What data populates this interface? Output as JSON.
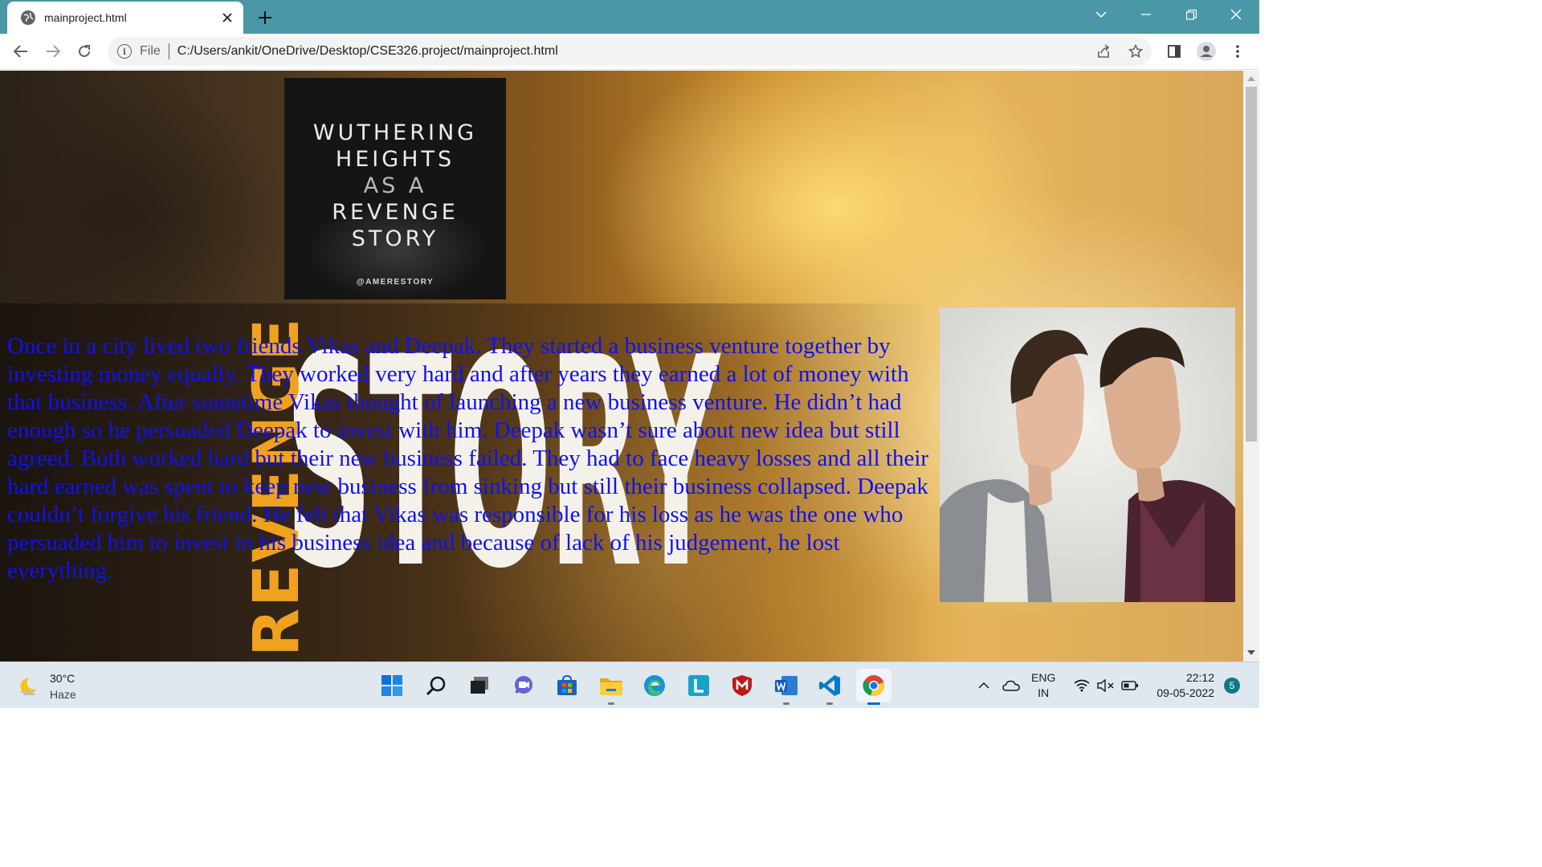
{
  "browser": {
    "tab_title": "mainproject.html",
    "address": {
      "scheme_label": "File",
      "url": "C:/Users/ankit/OneDrive/Desktop/CSE326.project/mainproject.html"
    }
  },
  "page": {
    "cover": {
      "lines": [
        "WUTHERING",
        "HEIGHTS",
        "AS A",
        "REVENGE",
        "STORY"
      ],
      "handle": "@AMERESTORY"
    },
    "background_words": {
      "story": "STORY",
      "revenge": "REVENGE"
    },
    "story_text": "Once in a city lived two friends Vikas and Deepak. They started a business venture together by investing money equally. They worked very hard and after years they earned a lot of money with that business. After sometime Vikas thought of launching a new business venture. He didn’t had enough so he persuaded Deepak to invest with him. Deepak wasn’t sure about new idea but still agreed. Both worked hard but their new business failed. They had to face heavy losses and all their hard earned was spent to keep new business from sinking but still their business collapsed. Deepak couldn’t forgive his friend. He felt that Vikas was responsible for his loss as he was the one who persuaded him to invest in his business idea and because of lack of his judgement, he lost everything.",
    "text_color": "#1010f5"
  },
  "taskbar": {
    "weather": {
      "temp": "30°C",
      "condition": "Haze"
    },
    "language": {
      "line1": "ENG",
      "line2": "IN"
    },
    "clock": {
      "time": "22:12",
      "date": "09-05-2022"
    },
    "notifications": "5"
  }
}
